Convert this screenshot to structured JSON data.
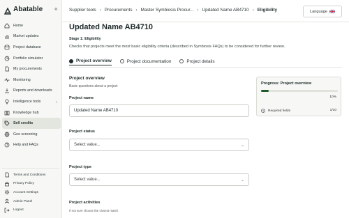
{
  "app": {
    "logo_text": "Abatable",
    "collapse_glyph": "«"
  },
  "sidebar": {
    "items": [
      {
        "label": "Home",
        "icon": "home-icon"
      },
      {
        "label": "Market updates",
        "icon": "chart-icon"
      },
      {
        "label": "Project database",
        "icon": "database-icon"
      },
      {
        "label": "Portfolio simulator",
        "icon": "pie-icon"
      },
      {
        "label": "My procurements",
        "icon": "document-icon"
      },
      {
        "label": "Monitoring",
        "icon": "pulse-icon"
      },
      {
        "label": "Reports and downloads",
        "icon": "download-icon"
      },
      {
        "label": "Intelligence tools",
        "icon": "bulb-icon",
        "has_chevron": true
      },
      {
        "label": "Knowledge hub",
        "icon": "book-icon"
      },
      {
        "label": "Sell credits",
        "icon": "tag-icon",
        "active": true
      },
      {
        "label": "Geo screening",
        "icon": "globe-icon"
      },
      {
        "label": "Help and FAQs",
        "icon": "help-icon"
      }
    ],
    "footer": [
      {
        "label": "Terms and Conditions",
        "icon": "document-icon"
      },
      {
        "label": "Privacy Policy",
        "icon": "lock-icon"
      },
      {
        "label": "Account Settings",
        "icon": "gear-icon"
      },
      {
        "label": "Admin Panel",
        "icon": "user-icon"
      },
      {
        "label": "Logout",
        "icon": "logout-icon"
      }
    ]
  },
  "breadcrumb": [
    "Supplier tools",
    "Procurements",
    "Master Symbiosis Procur...",
    "Updated Name AB4710",
    "Eligibility"
  ],
  "language_button": {
    "label": "Language"
  },
  "page": {
    "title": "Updated Name AB4710",
    "stage": "Stage 1: Eligibility",
    "description": "Checks that projects meet the most basic eligibility criteria (described in Symbiosis FAQs) to be considered for further review."
  },
  "tabs": [
    {
      "label": "Project overview",
      "active": true
    },
    {
      "label": "Project documentation",
      "active": false
    },
    {
      "label": "Project details",
      "active": false
    }
  ],
  "section": {
    "title": "Project overview",
    "subtitle": "Basic questions about a project"
  },
  "form": {
    "project_name_label": "Project name",
    "project_name_value": "Updated Name AB4710",
    "project_status_label": "Project status",
    "project_status_placeholder": "Select value...",
    "project_type_label": "Project type",
    "project_type_placeholder": "Select value...",
    "project_activities_label": "Project activities",
    "project_activities_hint": "If not sure choose the closest match"
  },
  "progress": {
    "title": "Progress: Project overview",
    "fraction": 0.1,
    "percent_label": "10%",
    "required_label": "Required fields",
    "required_value": "1/10"
  },
  "colors": {
    "accent": "#1f5a2a",
    "active_bg": "#e2e6de"
  }
}
